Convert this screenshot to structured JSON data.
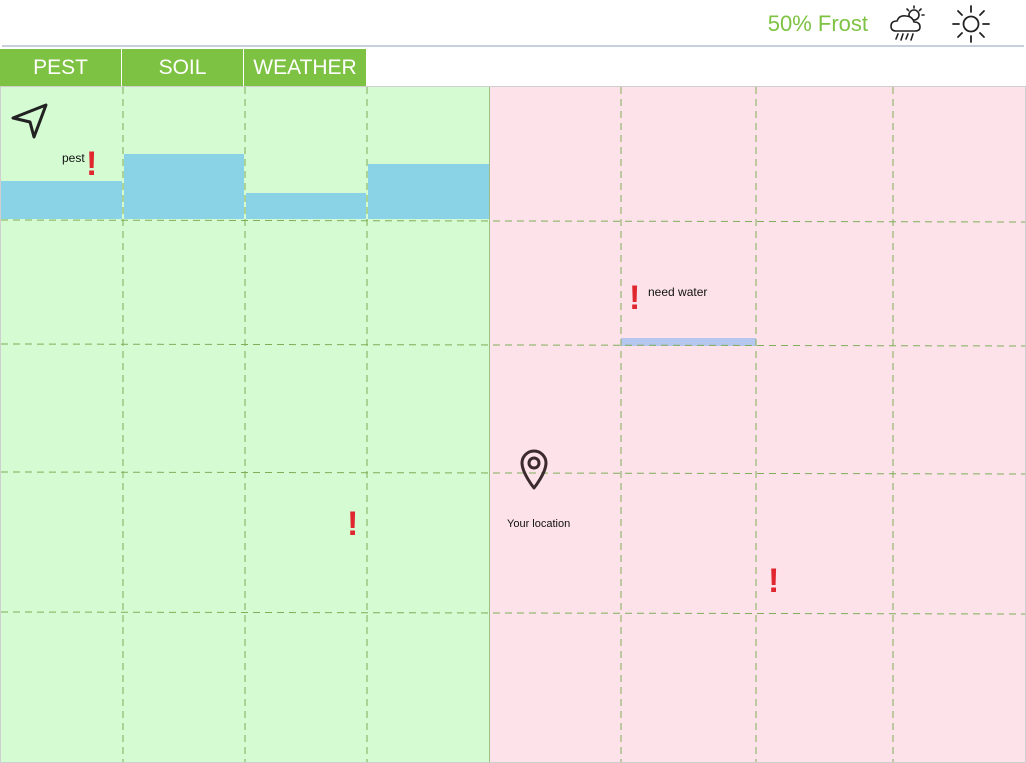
{
  "header": {
    "forecast_text": "50% Frost",
    "icons": [
      "cloud-rain-sun-icon",
      "sun-icon"
    ],
    "accent_color": "#7dc242"
  },
  "tabs": [
    {
      "label": "PEST"
    },
    {
      "label": "SOIL"
    },
    {
      "label": "WEATHER"
    }
  ],
  "map": {
    "zones": [
      {
        "name": "healthy",
        "color": "#d5fbd2"
      },
      {
        "name": "alert",
        "color": "#fde2ea"
      }
    ],
    "markers": {
      "pest_label": "pest",
      "water_label": "need water",
      "location_label": "Your location"
    },
    "icons": [
      "navigation-arrow-icon",
      "location-pin-icon",
      "exclamation-icon"
    ]
  }
}
